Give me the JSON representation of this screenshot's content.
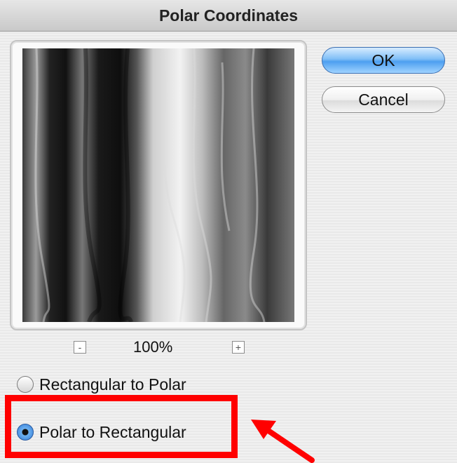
{
  "window": {
    "title": "Polar Coordinates"
  },
  "buttons": {
    "ok": "OK",
    "cancel": "Cancel"
  },
  "preview": {
    "zoom_value": "100%",
    "zoom_out_glyph": "-",
    "zoom_in_glyph": "+"
  },
  "options": {
    "rect_to_polar": {
      "label": "Rectangular to Polar",
      "selected": false
    },
    "polar_to_rect": {
      "label": "Polar to Rectangular",
      "selected": true
    }
  },
  "annotation": {
    "highlight_color": "#ff0000",
    "arrow_color": "#ff0000"
  },
  "icons": {
    "zoom_out": "minus-icon",
    "zoom_in": "plus-icon",
    "annotation_arrow": "arrow-icon"
  }
}
